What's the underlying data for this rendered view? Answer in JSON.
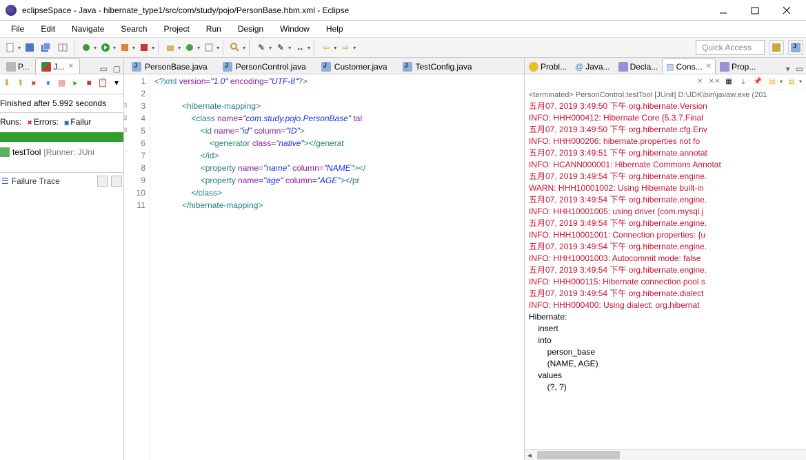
{
  "window": {
    "title": "eclipseSpace - Java - hibernate_type1/src/com/study/pojo/PersonBase.hbm.xml - Eclipse"
  },
  "menu": [
    "File",
    "Edit",
    "Navigate",
    "Search",
    "Project",
    "Run",
    "Design",
    "Window",
    "Help"
  ],
  "quick_access": "Quick Access",
  "left": {
    "tabs": [
      {
        "label": "P...",
        "icon": "pkg"
      },
      {
        "label": "J...",
        "icon": "junit",
        "active": true
      }
    ],
    "finished_msg": "Finished after 5.992 seconds",
    "runs_label": "Runs:",
    "errors_label": "Errors:",
    "failures_label": "Failur",
    "tree_item": "testTool",
    "tree_runner": "[Runner: JUni",
    "failure_trace": "Failure Trace"
  },
  "editor": {
    "tabs": [
      {
        "label": "PersonBase.java",
        "icon": "java"
      },
      {
        "label": "PersonControl.java",
        "icon": "java"
      },
      {
        "label": "Customer.java",
        "icon": "java"
      },
      {
        "label": "TestConfig.java",
        "icon": "java"
      }
    ],
    "lines": {
      "l1a": "<?xml",
      "l1b": " version=",
      "l1c": "\"1.0\"",
      "l1d": " encoding=",
      "l1e": "\"UTF-8\"",
      "l1f": "?>",
      "l3": "<hibernate-mapping>",
      "l4a": "<class",
      "l4b": " name=",
      "l4c": "\"com.study.pojo.PersonBase\"",
      "l4d": " tal",
      "l5a": "<id",
      "l5b": " name=",
      "l5c": "\"id\"",
      "l5d": " column=",
      "l5e": "\"ID\"",
      "l5f": ">",
      "l6a": "<generator",
      "l6b": " class=",
      "l6c": "\"native\"",
      "l6d": "></generat",
      "l7": "</id>",
      "l8a": "<property",
      "l8b": " name=",
      "l8c": "\"name\"",
      "l8d": " column=",
      "l8e": "\"NAME\"",
      "l8f": "></",
      "l9a": "<property",
      "l9b": " name=",
      "l9c": "\"age\"",
      "l9d": " column=",
      "l9e": "\"AGE\"",
      "l9f": "></pr",
      "l10": "</class>",
      "l11": "</hibernate-mapping>"
    }
  },
  "right": {
    "tabs": [
      {
        "label": "Probl...",
        "icon": "prob"
      },
      {
        "label": "Java..."
      },
      {
        "label": "Decla..."
      },
      {
        "label": "Cons...",
        "active": true
      },
      {
        "label": "Prop..."
      }
    ],
    "console_head": "<terminated> PersonControl.testTool [JUnit] D:\\JDK\\bin\\javaw.exe (201",
    "lines": [
      {
        "c": "red",
        "t": "五月07, 2019 3:49:50 下午 org.hibernate.Version"
      },
      {
        "c": "red",
        "t": "INFO: HHH000412: Hibernate Core {5.3.7.Final"
      },
      {
        "c": "red",
        "t": "五月07, 2019 3:49:50 下午 org.hibernate.cfg.Env"
      },
      {
        "c": "red",
        "t": "INFO: HHH000206: hibernate.properties not fo"
      },
      {
        "c": "red",
        "t": "五月07, 2019 3:49:51 下午 org.hibernate.annotat"
      },
      {
        "c": "red",
        "t": "INFO: HCANN000001: Hibernate Commons Annotat"
      },
      {
        "c": "red",
        "t": "五月07, 2019 3:49:54 下午 org.hibernate.engine."
      },
      {
        "c": "red",
        "t": "WARN: HHH10001002: Using Hibernate built-in "
      },
      {
        "c": "red",
        "t": "五月07, 2019 3:49:54 下午 org.hibernate.engine."
      },
      {
        "c": "red",
        "t": "INFO: HHH10001005: using driver [com.mysql.j"
      },
      {
        "c": "red",
        "t": "五月07, 2019 3:49:54 下午 org.hibernate.engine."
      },
      {
        "c": "red",
        "t": "INFO: HHH10001001: Connection properties: {u"
      },
      {
        "c": "red",
        "t": "五月07, 2019 3:49:54 下午 org.hibernate.engine."
      },
      {
        "c": "red",
        "t": "INFO: HHH10001003: Autocommit mode: false"
      },
      {
        "c": "red",
        "t": "五月07, 2019 3:49:54 下午 org.hibernate.engine."
      },
      {
        "c": "red",
        "t": "INFO: HHH000115: Hibernate connection pool s"
      },
      {
        "c": "red",
        "t": "五月07, 2019 3:49:54 下午 org.hibernate.dialect"
      },
      {
        "c": "red",
        "t": "INFO: HHH000400: Using dialect: org.hibernat"
      },
      {
        "c": "blk",
        "t": "Hibernate: "
      },
      {
        "c": "blk",
        "t": "    insert "
      },
      {
        "c": "blk",
        "t": "    into"
      },
      {
        "c": "blk",
        "t": "        person_base"
      },
      {
        "c": "blk",
        "t": "        (NAME, AGE) "
      },
      {
        "c": "blk",
        "t": "    values"
      },
      {
        "c": "blk",
        "t": "        (?, ?)"
      }
    ]
  }
}
